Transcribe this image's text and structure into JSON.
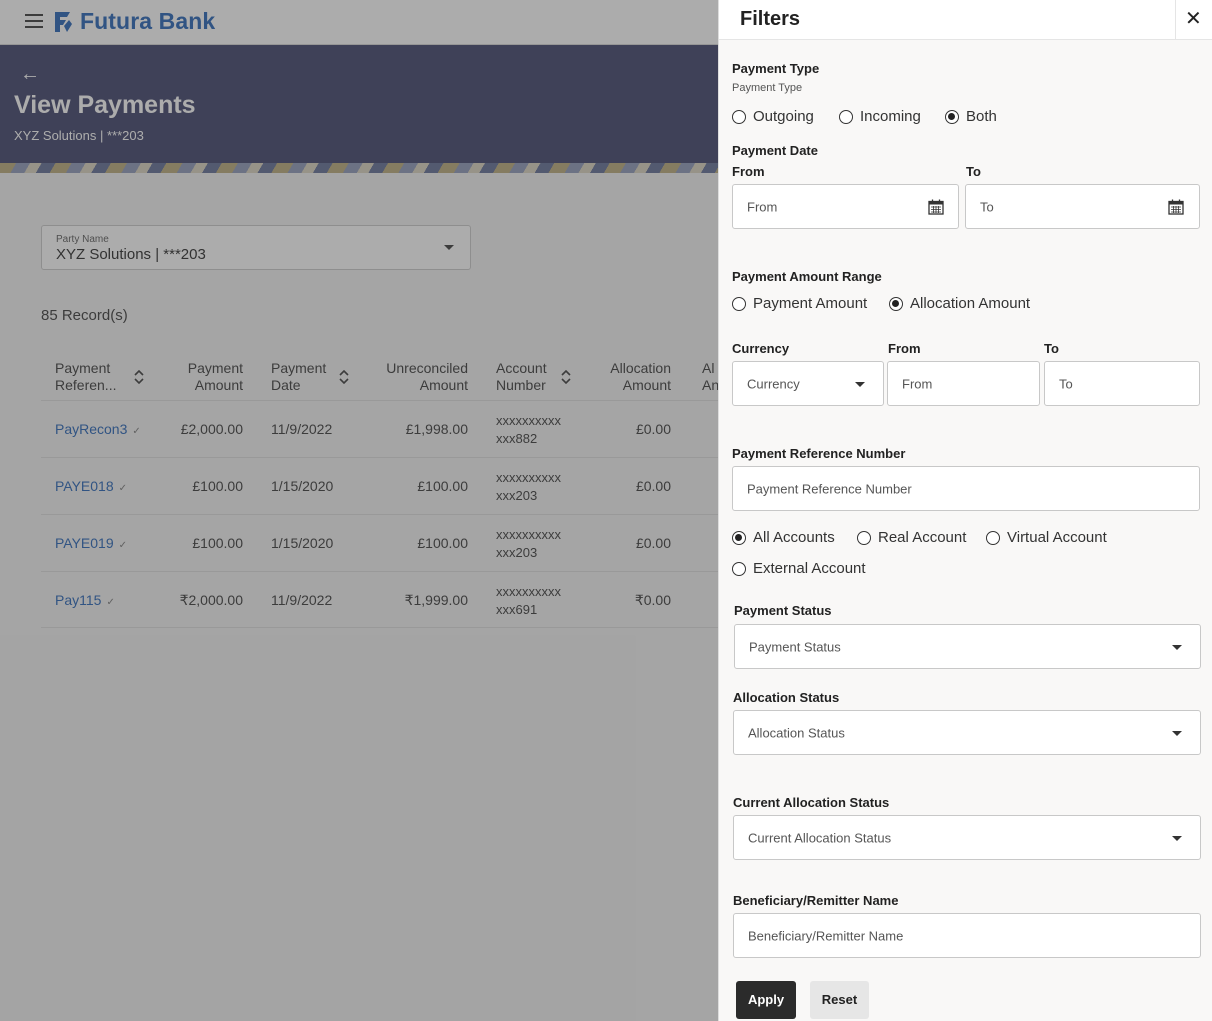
{
  "header": {
    "brand": "Futura Bank"
  },
  "hero": {
    "title": "View Payments",
    "subtitle": "XYZ Solutions | ***203"
  },
  "party": {
    "label": "Party Name",
    "value": "XYZ Solutions | ***203"
  },
  "records": "85 Record(s)",
  "table": {
    "headers": {
      "ref_line1": "Payment",
      "ref_line2": "Referen...",
      "amt_line1": "Payment",
      "amt_line2": "Amount",
      "date_line1": "Payment",
      "date_line2": "Date",
      "unrec_line1": "Unreconciled",
      "unrec_line2": "Amount",
      "acct_line1": "Account",
      "acct_line2": "Number",
      "alloc_line1": "Allocation",
      "alloc_line2": "Amount",
      "cut_line1": "Al",
      "cut_line2": "An"
    },
    "rows": [
      {
        "ref": "PayRecon3",
        "amount": "£2,000.00",
        "date": "11/9/2022",
        "unreconciled": "£1,998.00",
        "acct1": "xxxxxxxxxx",
        "acct2": "xxx882",
        "allocation": "£0.00"
      },
      {
        "ref": "PAYE018",
        "amount": "£100.00",
        "date": "1/15/2020",
        "unreconciled": "£100.00",
        "acct1": "xxxxxxxxxx",
        "acct2": "xxx203",
        "allocation": "£0.00"
      },
      {
        "ref": "PAYE019",
        "amount": "£100.00",
        "date": "1/15/2020",
        "unreconciled": "£100.00",
        "acct1": "xxxxxxxxxx",
        "acct2": "xxx203",
        "allocation": "£0.00"
      },
      {
        "ref": "Pay115",
        "amount": "₹2,000.00",
        "date": "11/9/2022",
        "unreconciled": "₹1,999.00",
        "acct1": "xxxxxxxxxx",
        "acct2": "xxx691",
        "allocation": "₹0.00"
      }
    ]
  },
  "filters": {
    "title": "Filters",
    "payment_type": {
      "label": "Payment Type",
      "sublabel": "Payment Type",
      "options": [
        "Outgoing",
        "Incoming",
        "Both"
      ]
    },
    "payment_date": {
      "label": "Payment Date",
      "from_label": "From",
      "to_label": "To",
      "from_placeholder": "From",
      "to_placeholder": "To"
    },
    "amount_range": {
      "label": "Payment Amount Range",
      "options": [
        "Payment Amount",
        "Allocation Amount"
      ]
    },
    "currency": {
      "label": "Currency",
      "placeholder": "Currency",
      "from_label": "From",
      "to_label": "To",
      "from_placeholder": "From",
      "to_placeholder": "To"
    },
    "reference": {
      "label": "Payment Reference Number",
      "placeholder": "Payment Reference Number"
    },
    "accounts": {
      "options": [
        "All Accounts",
        "Real Account",
        "Virtual Account",
        "External Account"
      ]
    },
    "payment_status": {
      "label": "Payment Status",
      "placeholder": "Payment Status"
    },
    "allocation_status": {
      "label": "Allocation Status",
      "placeholder": "Allocation Status"
    },
    "current_allocation_status": {
      "label": "Current Allocation Status",
      "placeholder": "Current Allocation Status"
    },
    "beneficiary": {
      "label": "Beneficiary/Remitter Name",
      "placeholder": "Beneficiary/Remitter Name"
    },
    "apply_label": "Apply",
    "reset_label": "Reset"
  }
}
